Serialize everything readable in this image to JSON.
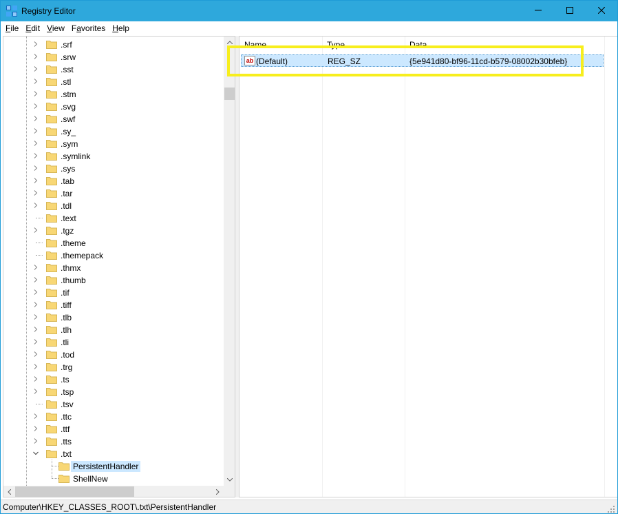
{
  "window": {
    "title": "Registry Editor",
    "icon": "registry-editor-icon",
    "controls": [
      "minimize-icon",
      "maximize-icon",
      "close-icon"
    ]
  },
  "menu": [
    {
      "label": "File",
      "accel": "F",
      "rest": "ile"
    },
    {
      "label": "Edit",
      "accel": "E",
      "rest": "dit"
    },
    {
      "label": "View",
      "accel": "V",
      "rest": "iew"
    },
    {
      "label": "Favorites",
      "accel": "a",
      "pre": "F",
      "rest": "vorites"
    },
    {
      "label": "Help",
      "accel": "H",
      "rest": "elp"
    }
  ],
  "tree": {
    "items": [
      {
        "label": ".srf",
        "expandable": true
      },
      {
        "label": ".srw",
        "expandable": true
      },
      {
        "label": ".sst",
        "expandable": true
      },
      {
        "label": ".stl",
        "expandable": true
      },
      {
        "label": ".stm",
        "expandable": true
      },
      {
        "label": ".svg",
        "expandable": true
      },
      {
        "label": ".swf",
        "expandable": true
      },
      {
        "label": ".sy_",
        "expandable": true
      },
      {
        "label": ".sym",
        "expandable": true
      },
      {
        "label": ".symlink",
        "expandable": true
      },
      {
        "label": ".sys",
        "expandable": true
      },
      {
        "label": ".tab",
        "expandable": true
      },
      {
        "label": ".tar",
        "expandable": true
      },
      {
        "label": ".tdl",
        "expandable": true
      },
      {
        "label": ".text",
        "expandable": false
      },
      {
        "label": ".tgz",
        "expandable": true
      },
      {
        "label": ".theme",
        "expandable": false
      },
      {
        "label": ".themepack",
        "expandable": false
      },
      {
        "label": ".thmx",
        "expandable": true
      },
      {
        "label": ".thumb",
        "expandable": true
      },
      {
        "label": ".tif",
        "expandable": true
      },
      {
        "label": ".tiff",
        "expandable": true
      },
      {
        "label": ".tlb",
        "expandable": true
      },
      {
        "label": ".tlh",
        "expandable": true
      },
      {
        "label": ".tli",
        "expandable": true
      },
      {
        "label": ".tod",
        "expandable": true
      },
      {
        "label": ".trg",
        "expandable": true
      },
      {
        "label": ".ts",
        "expandable": true
      },
      {
        "label": ".tsp",
        "expandable": true
      },
      {
        "label": ".tsv",
        "expandable": false
      },
      {
        "label": ".ttc",
        "expandable": true
      },
      {
        "label": ".ttf",
        "expandable": true
      },
      {
        "label": ".tts",
        "expandable": true
      },
      {
        "label": ".txt",
        "expandable": true,
        "expanded": true
      }
    ],
    "children": [
      {
        "label": "PersistentHandler",
        "selected": true
      },
      {
        "label": "ShellNew",
        "selected": false
      }
    ]
  },
  "values": {
    "columns": [
      "Name",
      "Type",
      "Data"
    ],
    "rows": [
      {
        "name": "(Default)",
        "type": "REG_SZ",
        "data": "{5e941d80-bf96-11cd-b579-08002b30bfeb}",
        "icon": "string-value-icon",
        "icon_text": "ab"
      }
    ]
  },
  "status": {
    "path": "Computer\\HKEY_CLASSES_ROOT\\.txt\\PersistentHandler"
  },
  "colors": {
    "titlebar": "#2ea8dc",
    "selection": "#cce8ff",
    "highlight": "#f7ee1d",
    "folder": "#f8d775"
  }
}
